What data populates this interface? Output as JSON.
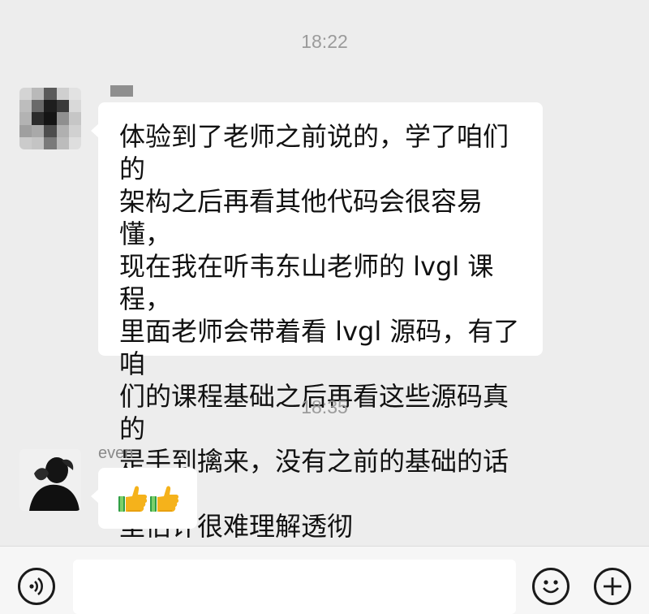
{
  "chat": {
    "timestamps": [
      "18:22",
      "18:35"
    ],
    "messages": [
      {
        "sender": "",
        "text": "体验到了老师之前说的，学了咱们的\n架构之后再看其他代码会很容易懂，\n现在我在听韦东山老师的 lvgl 课程，\n里面老师会带着看 lvgl 源码，有了咱\n们的课程基础之后再看这些源码真的\n是手到擒来，没有之前的基础的话这\n里估计很难理解透彻"
      },
      {
        "sender": "even",
        "emoji": "👍👍"
      }
    ]
  },
  "input_bar": {
    "voice_icon": "voice-icon",
    "emoji_icon": "emoji-icon",
    "add_icon": "plus-icon"
  },
  "colors": {
    "background": "#ededed",
    "bubble": "#ffffff",
    "timestamp": "#9b9b9b",
    "bottom_bar": "#f6f6f6"
  }
}
